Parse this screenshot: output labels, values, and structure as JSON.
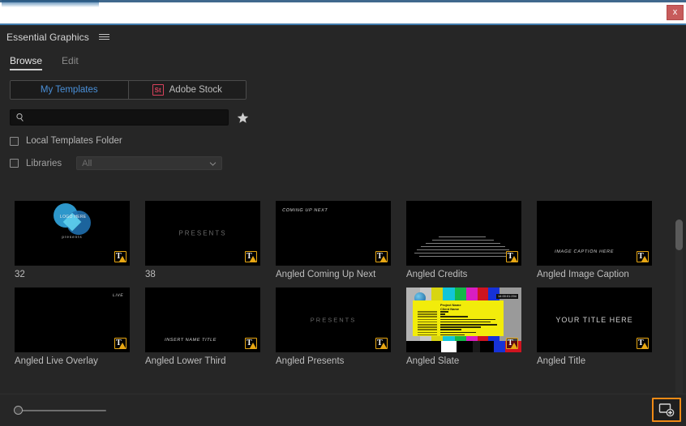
{
  "window": {
    "close_label": "x"
  },
  "panel": {
    "title": "Essential Graphics",
    "menu_icon": "hamburger-menu-icon"
  },
  "tabs": [
    {
      "label": "Browse",
      "active": true
    },
    {
      "label": "Edit",
      "active": false
    }
  ],
  "source_toggle": {
    "my_templates_label": "My Templates",
    "adobe_stock_label": "Adobe Stock",
    "stock_badge": "St",
    "selected": "My Templates"
  },
  "search": {
    "value": "",
    "placeholder": "",
    "icon": "search-icon",
    "favorite_icon": "star-icon"
  },
  "filters": {
    "local_templates_label": "Local Templates Folder",
    "local_templates_checked": false,
    "libraries_label": "Libraries",
    "libraries_checked": false,
    "libraries_select_value": "All"
  },
  "templates": [
    {
      "label": "32",
      "art": "logo",
      "badge": "text-warning-badge"
    },
    {
      "label": "38",
      "art": "presents",
      "overlay": "PRESENTS",
      "badge": "text-warning-badge"
    },
    {
      "label": "Angled Coming Up Next",
      "art": "comingup",
      "overlay": "COMING UP NEXT",
      "badge": "text-warning-badge"
    },
    {
      "label": "Angled Credits",
      "art": "credits",
      "badge": "text-warning-badge"
    },
    {
      "label": "Angled Image Caption",
      "art": "caption",
      "overlay": "IMAGE CAPTION HERE",
      "badge": "text-warning-badge"
    },
    {
      "label": "Angled Live Overlay",
      "art": "live",
      "overlay": "LIVE",
      "badge": "text-warning-badge"
    },
    {
      "label": "Angled Lower Third",
      "art": "lower",
      "overlay": "INSERT NAME TITLE",
      "badge": "text-warning-badge"
    },
    {
      "label": "Angled Presents",
      "art": "presents",
      "overlay": "PRESENTS",
      "badge": "text-warning-badge"
    },
    {
      "label": "Angled Slate",
      "art": "slate",
      "badge": "text-warning-badge"
    },
    {
      "label": "Angled Title",
      "art": "title",
      "overlay": "YOUR TITLE HERE",
      "badge": "text-warning-badge"
    }
  ],
  "slate": {
    "project_name": "Project Name",
    "client_name": "Client Name",
    "timecode": "14:00:01:204"
  },
  "badge": {
    "glyph": "T"
  },
  "footer": {
    "zoom_value": 0,
    "install_icon": "install-motion-graphics-template-icon",
    "install_highlight_color": "#f08a15"
  },
  "scrollbar": {
    "position": 0
  }
}
